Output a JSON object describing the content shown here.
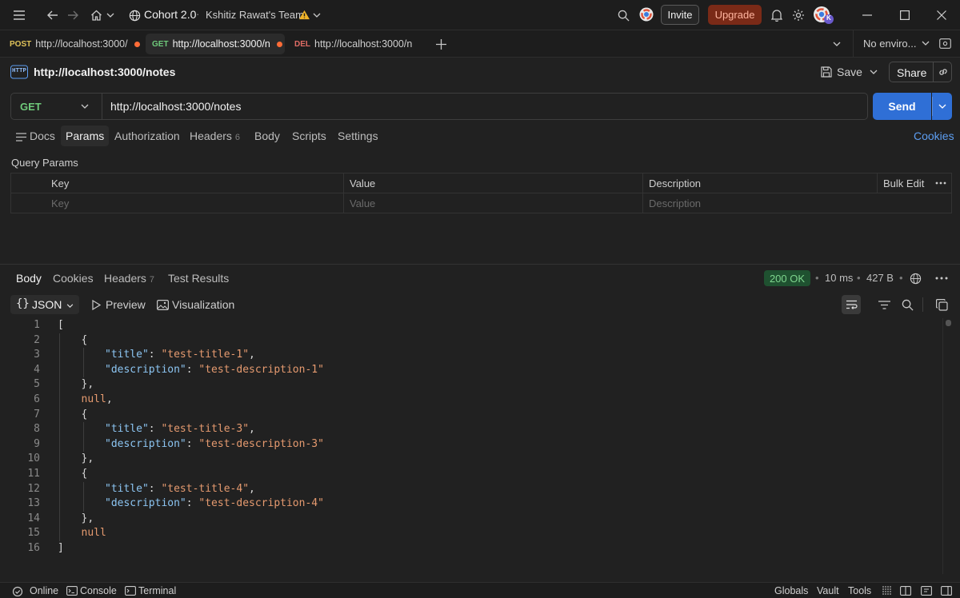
{
  "titlebar": {
    "workspace": "Cohort 2.0",
    "separator": "·",
    "team": "Kshitiz Rawat's Team",
    "invite_label": "Invite",
    "upgrade_label": "Upgrade",
    "avatar_badge": "K"
  },
  "tabs": [
    {
      "method": "POST",
      "url": "http://localhost:3000/",
      "unsaved": true
    },
    {
      "method": "GET",
      "url": "http://localhost:3000/n",
      "unsaved": true,
      "active": true
    },
    {
      "method": "DEL",
      "url": "http://localhost:3000/n",
      "unsaved": false
    }
  ],
  "environment": {
    "selected": "No enviro..."
  },
  "request": {
    "protocol_icon": "HTTP",
    "title": "http://localhost:3000/notes",
    "save_label": "Save",
    "share_label": "Share",
    "method": "GET",
    "url": "http://localhost:3000/notes",
    "send_label": "Send"
  },
  "request_tabs": [
    {
      "label": "Docs"
    },
    {
      "label": "Params",
      "active": true
    },
    {
      "label": "Authorization"
    },
    {
      "label": "Headers",
      "count": "6"
    },
    {
      "label": "Body"
    },
    {
      "label": "Scripts"
    },
    {
      "label": "Settings"
    }
  ],
  "cookies_link": "Cookies",
  "params": {
    "section_title": "Query Params",
    "columns": [
      "Key",
      "Value",
      "Description"
    ],
    "bulk_edit": "Bulk Edit",
    "placeholders": {
      "key": "Key",
      "value": "Value",
      "description": "Description"
    }
  },
  "response": {
    "tabs": [
      {
        "label": "Body",
        "active": true
      },
      {
        "label": "Cookies"
      },
      {
        "label": "Headers",
        "count": "7"
      },
      {
        "label": "Test Results"
      }
    ],
    "status": "200 OK",
    "time": "10 ms",
    "size": "427 B",
    "format": "JSON",
    "preview_label": "Preview",
    "visualization_label": "Visualization",
    "lines": [
      [
        [
          "p",
          "["
        ]
      ],
      [
        [
          "p",
          "{"
        ]
      ],
      [
        [
          "k",
          "\"title\""
        ],
        [
          "p",
          ": "
        ],
        [
          "s",
          "\"test-title-1\""
        ],
        [
          "p",
          ","
        ]
      ],
      [
        [
          "k",
          "\"description\""
        ],
        [
          "p",
          ": "
        ],
        [
          "s",
          "\"test-description-1\""
        ]
      ],
      [
        [
          "p",
          "},"
        ]
      ],
      [
        [
          "n",
          "null"
        ],
        [
          "p",
          ","
        ]
      ],
      [
        [
          "p",
          "{"
        ]
      ],
      [
        [
          "k",
          "\"title\""
        ],
        [
          "p",
          ": "
        ],
        [
          "s",
          "\"test-title-3\""
        ],
        [
          "p",
          ","
        ]
      ],
      [
        [
          "k",
          "\"description\""
        ],
        [
          "p",
          ": "
        ],
        [
          "s",
          "\"test-description-3\""
        ]
      ],
      [
        [
          "p",
          "},"
        ]
      ],
      [
        [
          "p",
          "{"
        ]
      ],
      [
        [
          "k",
          "\"title\""
        ],
        [
          "p",
          ": "
        ],
        [
          "s",
          "\"test-title-4\""
        ],
        [
          "p",
          ","
        ]
      ],
      [
        [
          "k",
          "\"description\""
        ],
        [
          "p",
          ": "
        ],
        [
          "s",
          "\"test-description-4\""
        ]
      ],
      [
        [
          "p",
          "},"
        ]
      ],
      [
        [
          "n",
          "null"
        ]
      ],
      [
        [
          "p",
          "]"
        ]
      ]
    ],
    "indent": [
      0,
      1,
      2,
      2,
      1,
      1,
      1,
      2,
      2,
      1,
      1,
      2,
      2,
      1,
      1,
      0
    ]
  },
  "footer": {
    "online": "Online",
    "console": "Console",
    "terminal": "Terminal",
    "globals": "Globals",
    "vault": "Vault",
    "tools": "Tools"
  },
  "colors": {
    "accent_blue": "#2f6fd6",
    "get": "#6fca7b",
    "post": "#e0c35a",
    "del": "#e06c65",
    "unsaved_dot": "#ff6c37",
    "status_ok": "#7fd68e"
  }
}
